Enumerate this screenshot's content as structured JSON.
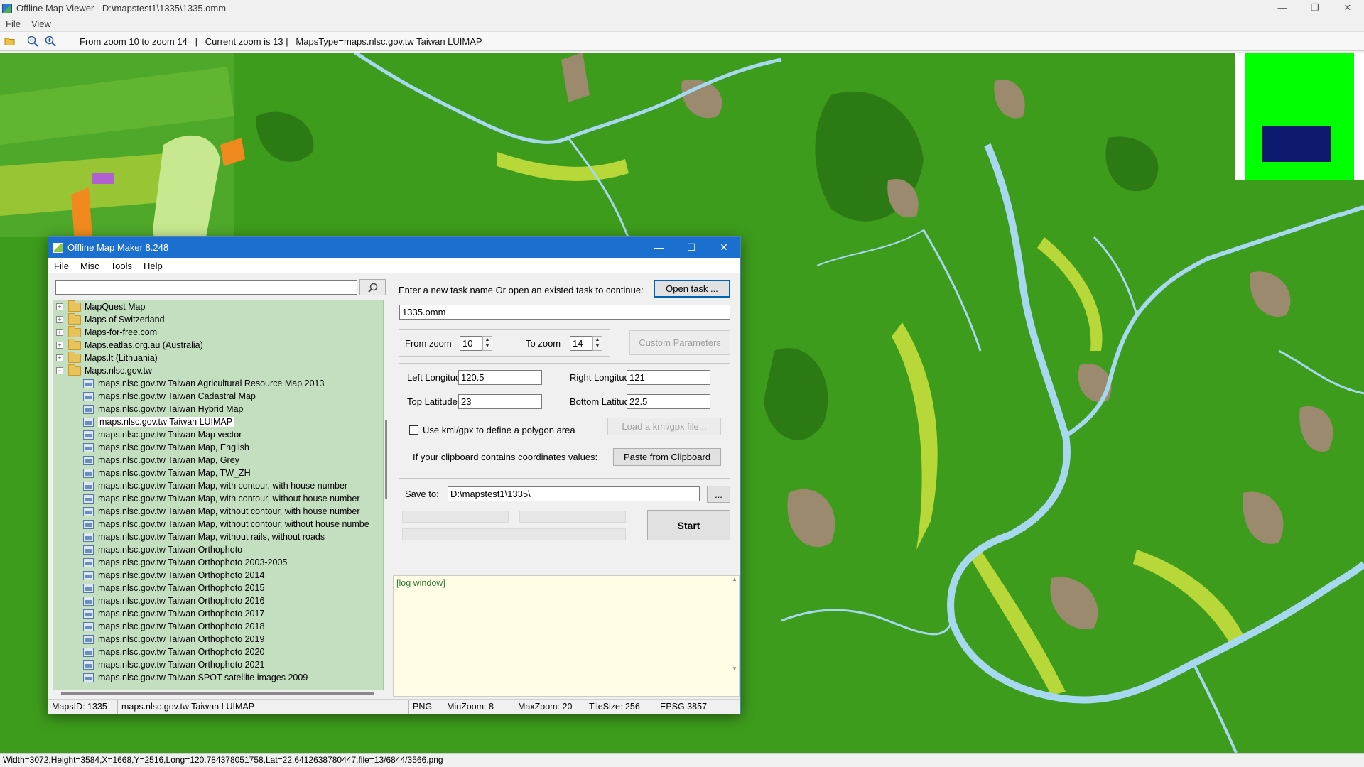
{
  "window": {
    "title": "Offline Map Viewer - D:\\mapstest1\\1335\\1335.omm",
    "controls": {
      "minimize": "—",
      "restore": "❐",
      "close": "✕"
    }
  },
  "menu": {
    "file": "File",
    "view": "View"
  },
  "toolbar": {
    "icons": [
      "folder-open-icon",
      "zoom-out-icon",
      "zoom-in-icon"
    ],
    "info": "From zoom 10 to zoom 14   |   Current zoom is 13 |   MapsType=maps.nlsc.gov.tw Taiwan LUIMAP"
  },
  "colors": {
    "map_base": "#3d9c1c",
    "map_dark": "#2c7a14",
    "map_light": "#b8d83a",
    "river": "#a6d8f0",
    "earth": "#9c8a6e",
    "minimap_bg": "#00ff00",
    "minimap_view": "#0d1a6e",
    "dialog_accent": "#1a6fcf",
    "tree_bg": "#c3dfc0",
    "log_bg": "#fffde6",
    "log_text": "#2e7d32"
  },
  "status_bar": {
    "text": "Width=3072,Height=3584,X=1668,Y=2516,Long=120.784378051758,Lat=22.6412638780447,file=13/6844/3566.png"
  },
  "dialog": {
    "title": "Offline Map Maker 8.248",
    "controls": {
      "minimize": "—",
      "maximize": "☐",
      "close": "✕"
    },
    "menu": {
      "file": "File",
      "misc": "Misc",
      "tools": "Tools",
      "help": "Help"
    },
    "search": {
      "value": "",
      "button_icon": "search-icon"
    },
    "tree": {
      "folders": [
        {
          "label": "MapQuest Map",
          "expander": "+"
        },
        {
          "label": "Maps of Switzerland",
          "expander": "+"
        },
        {
          "label": "Maps-for-free.com",
          "expander": "+"
        },
        {
          "label": "Maps.eatlas.org.au (Australia)",
          "expander": "+"
        },
        {
          "label": "Maps.lt (Lithuania)",
          "expander": "+"
        },
        {
          "label": "Maps.nlsc.gov.tw",
          "expander": "−"
        }
      ],
      "items": [
        "maps.nlsc.gov.tw Taiwan Agricultural Resource Map 2013",
        "maps.nlsc.gov.tw Taiwan Cadastral Map",
        "maps.nlsc.gov.tw Taiwan Hybrid Map",
        "maps.nlsc.gov.tw Taiwan LUIMAP",
        "maps.nlsc.gov.tw Taiwan Map vector",
        "maps.nlsc.gov.tw Taiwan Map, English",
        "maps.nlsc.gov.tw Taiwan Map, Grey",
        "maps.nlsc.gov.tw Taiwan Map, TW_ZH",
        "maps.nlsc.gov.tw Taiwan Map, with contour, with house number",
        "maps.nlsc.gov.tw Taiwan Map, with contour, without house number",
        "maps.nlsc.gov.tw Taiwan Map, without contour, with house number",
        "maps.nlsc.gov.tw Taiwan Map, without contour, without house numbe",
        "maps.nlsc.gov.tw Taiwan Map, without rails, without roads",
        "maps.nlsc.gov.tw Taiwan Orthophoto",
        "maps.nlsc.gov.tw Taiwan Orthophoto 2003-2005",
        "maps.nlsc.gov.tw Taiwan Orthophoto 2014",
        "maps.nlsc.gov.tw Taiwan Orthophoto 2015",
        "maps.nlsc.gov.tw Taiwan Orthophoto 2016",
        "maps.nlsc.gov.tw Taiwan Orthophoto 2017",
        "maps.nlsc.gov.tw Taiwan Orthophoto 2018",
        "maps.nlsc.gov.tw Taiwan Orthophoto 2019",
        "maps.nlsc.gov.tw Taiwan Orthophoto 2020",
        "maps.nlsc.gov.tw Taiwan Orthophoto 2021",
        "maps.nlsc.gov.tw Taiwan SPOT satellite images 2009"
      ],
      "selected_item": "maps.nlsc.gov.tw Taiwan LUIMAP"
    },
    "task": {
      "prompt": "Enter a new task name Or open an existed task to continue:",
      "open_button": "Open task ...",
      "name_value": "1335.omm"
    },
    "zoom": {
      "from_label": "From zoom",
      "from_value": "10",
      "to_label": "To zoom",
      "to_value": "14",
      "custom_button": "Custom Parameters"
    },
    "bounds": {
      "left_lon_label": "Left Longitude",
      "left_lon": "120.5",
      "right_lon_label": "Right Longitude",
      "right_lon": "121",
      "top_lat_label": "Top Latitude",
      "top_lat": "23",
      "bottom_lat_label": "Bottom Latitude",
      "bottom_lat": "22.5",
      "kml_label": "Use kml/gpx to define a polygon area",
      "kml_checked": false,
      "kml_button": "Load a kml/gpx file...",
      "clipboard_label": "If your clipboard contains coordinates values:",
      "clipboard_button": "Paste from Clipboard"
    },
    "save": {
      "label": "Save to:",
      "path": "D:\\mapstest1\\1335\\",
      "browse": "..."
    },
    "start_button": "Start",
    "log_label": "[log window]",
    "status": {
      "maps_id": "MapsID: 1335",
      "map_name": "maps.nlsc.gov.tw Taiwan LUIMAP",
      "format": "PNG",
      "min_zoom": "MinZoom: 8",
      "max_zoom": "MaxZoom: 20",
      "tile_size": "TileSize: 256",
      "epsg": "EPSG:3857"
    }
  }
}
